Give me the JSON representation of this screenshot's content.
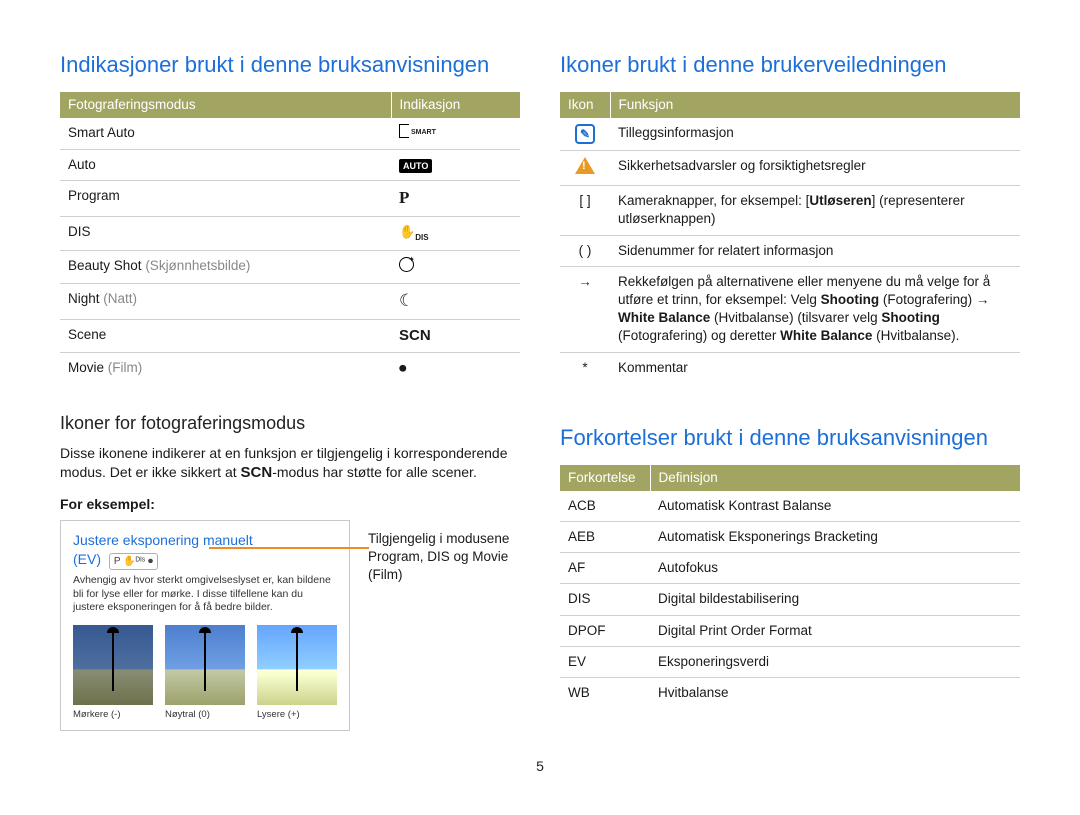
{
  "left": {
    "heading": "Indikasjoner brukt i denne bruksanvisningen",
    "table1": {
      "headers": [
        "Fotograferingsmodus",
        "Indikasjon"
      ],
      "rows": [
        {
          "mode": "Smart Auto",
          "note": "",
          "icon": "smart"
        },
        {
          "mode": "Auto",
          "note": "",
          "icon": "auto"
        },
        {
          "mode": "Program",
          "note": "",
          "icon": "P"
        },
        {
          "mode": "DIS",
          "note": "",
          "icon": "dis"
        },
        {
          "mode": "Beauty Shot",
          "note": "(Skjønnhetsbilde)",
          "icon": "face"
        },
        {
          "mode": "Night",
          "note": "(Natt)",
          "icon": "moon"
        },
        {
          "mode": "Scene",
          "note": "",
          "icon": "SCN"
        },
        {
          "mode": "Movie",
          "note": "(Film)",
          "icon": "movie"
        }
      ]
    },
    "sub_heading": "Ikoner for fotograferingsmodus",
    "sub_text_a": "Disse ikonene indikerer at en funksjon er tilgjengelig i korresponderende modus. Det er ikke sikkert at ",
    "sub_text_scn": "SCN",
    "sub_text_b": "-modus har støtte for alle scener.",
    "for_example_label": "For eksempel:",
    "example": {
      "title_line1": "Justere eksponering manuelt",
      "title_ev": "(EV)",
      "mode_chip": "P ✋ᴰᴵˢ ⏺",
      "body": "Avhengig av hvor sterkt omgivelseslyset er, kan bildene bli for lyse eller for mørke. I disse tilfellene kan du justere eksponeringen for å få bedre bilder.",
      "thumbs": [
        {
          "variant": "darker",
          "label": "Mørkere (-)"
        },
        {
          "variant": "",
          "label": "Nøytral (0)"
        },
        {
          "variant": "lighter",
          "label": "Lysere (+)"
        }
      ]
    },
    "callout": "Tilgjengelig i modusene Program, DIS og Movie (Film)"
  },
  "right": {
    "heading_icons": "Ikoner brukt i denne brukerveiledningen",
    "icons_table": {
      "headers": [
        "Ikon",
        "Funksjon"
      ],
      "rows": [
        {
          "icon": "info",
          "text": "Tilleggsinformasjon"
        },
        {
          "icon": "warn",
          "text": "Sikkerhetsadvarsler og forsiktighetsregler"
        },
        {
          "icon": "[ ]",
          "html": "Kameraknapper, for eksempel: [<b>Utløseren</b>] (representerer utløserknappen)"
        },
        {
          "icon": "( )",
          "text": "Sidenummer for relatert informasjon"
        },
        {
          "icon": "→",
          "html": "Rekkefølgen på alternativene eller menyene du må velge for å utføre et trinn, for eksempel: Velg <b>Shooting</b> (Fotografering) → <b>White Balance</b> (Hvitbalanse) (tilsvarer velg <b>Shooting</b> (Fotografering) og deretter <b>White Balance</b> (Hvitbalanse)."
        },
        {
          "icon": "*",
          "text": "Kommentar"
        }
      ]
    },
    "heading_abbr": "Forkortelser brukt i denne bruksanvisningen",
    "abbr_table": {
      "headers": [
        "Forkortelse",
        "Definisjon"
      ],
      "rows": [
        {
          "k": "ACB",
          "v": "Automatisk Kontrast Balanse"
        },
        {
          "k": "AEB",
          "v": "Automatisk Eksponerings Bracketing"
        },
        {
          "k": "AF",
          "v": "Autofokus"
        },
        {
          "k": "DIS",
          "v": "Digital bildestabilisering"
        },
        {
          "k": "DPOF",
          "v": "Digital Print Order Format"
        },
        {
          "k": "EV",
          "v": "Eksponeringsverdi"
        },
        {
          "k": "WB",
          "v": "Hvitbalanse"
        }
      ]
    }
  },
  "page_number": "5"
}
